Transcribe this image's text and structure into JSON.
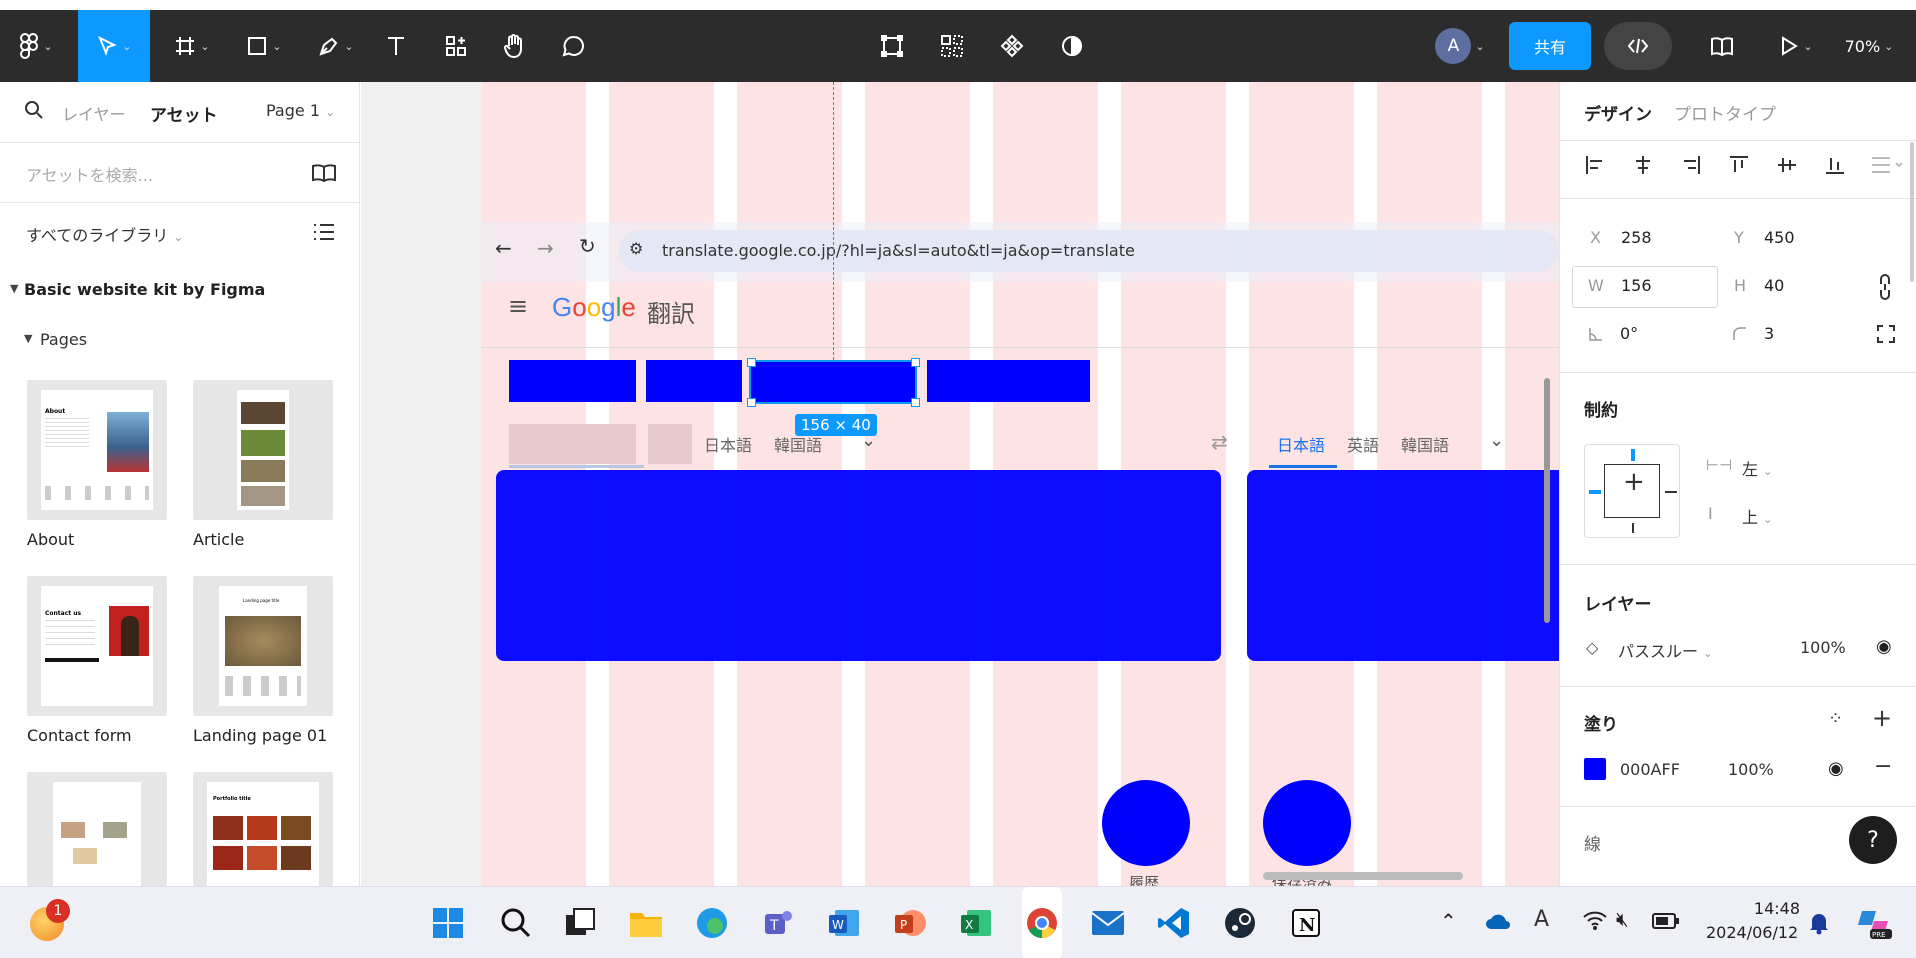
{
  "toolbar": {
    "share": "共有",
    "zoom": "70%",
    "avatar": "A"
  },
  "left": {
    "tab_layers": "レイヤー",
    "tab_assets": "アセット",
    "page": "Page 1",
    "search_placeholder": "アセットを検索...",
    "library_filter": "すべてのライブラリ",
    "kit_title": "Basic website kit by Figma",
    "pages_label": "Pages",
    "thumbs": [
      {
        "label": "About"
      },
      {
        "label": "Article"
      },
      {
        "label": "Contact form"
      },
      {
        "label": "Landing page 01"
      },
      {
        "label": ""
      },
      {
        "label": ""
      }
    ]
  },
  "canvas": {
    "url": "translate.google.co.jp/?hl=ja&sl=auto&tl=ja&op=translate",
    "google": "Google",
    "translate": "翻訳",
    "size_badge": "156 × 40",
    "src_langs": [
      "日本語",
      "韓国語"
    ],
    "tgt_langs": [
      "日本語",
      "英語",
      "韓国語"
    ],
    "history": "履歴",
    "saved": "保存済み"
  },
  "right": {
    "tab_design": "デザイン",
    "tab_prototype": "プロトタイプ",
    "x_label": "X",
    "x": "258",
    "y_label": "Y",
    "y": "450",
    "w_label": "W",
    "w": "156",
    "h_label": "H",
    "h": "40",
    "rotation": "0°",
    "radius": "3",
    "constraints_title": "制約",
    "constraint_h": "左",
    "constraint_v": "上",
    "layer_title": "レイヤー",
    "blend": "パススルー",
    "layer_opacity": "100%",
    "fill_title": "塗り",
    "fill_hex": "000AFF",
    "fill_opacity": "100%",
    "stroke_title": "線",
    "fill_color": "#000AFF"
  },
  "taskbar": {
    "time": "14:48",
    "date": "2024/06/12",
    "badge": "1"
  },
  "colors": {
    "accent": "#0d99ff",
    "toolbar": "#2c2c2c",
    "fill": "#0000ff"
  }
}
